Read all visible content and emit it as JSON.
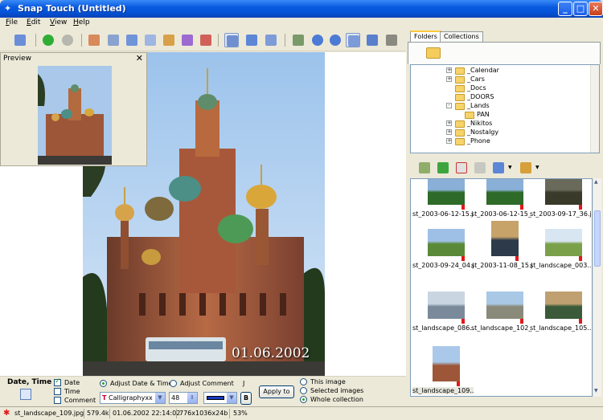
{
  "window": {
    "title": "Snap Touch (Untitled)"
  },
  "menu": [
    "File",
    "Edit",
    "View",
    "Help"
  ],
  "preview": {
    "title": "Preview"
  },
  "photo": {
    "date_stamp": "01.06.2002"
  },
  "bottom_panel": {
    "title": "Date, Time",
    "checkboxes": {
      "date": "Date",
      "time": "Time",
      "comment": "Comment"
    },
    "checked": {
      "date": true,
      "time": false,
      "comment": false
    },
    "adjust_date_time": "Adjust Date & Time",
    "adjust_comment": "Adjust Comment",
    "font": "Calligraphyxx",
    "size": "48",
    "bold_label": "B",
    "apply_button": "Apply to",
    "scope": {
      "this_image": "This image",
      "selected": "Selected images",
      "whole": "Whole collection"
    },
    "scope_selected": "whole",
    "extra_char": "J"
  },
  "status": {
    "filename": "st_landscape_109.jpg",
    "filesize": "579.4k",
    "datetime": "01.06.2002 22:14:02",
    "dimensions": "776x1036x24b",
    "zoom": "53%"
  },
  "tabs": [
    "Folders",
    "Collections"
  ],
  "tree": [
    {
      "label": "_Calendar",
      "level": 1,
      "expander": "+"
    },
    {
      "label": "_Cars",
      "level": 1,
      "expander": "+"
    },
    {
      "label": "_Docs",
      "level": 1,
      "expander": ""
    },
    {
      "label": "_DOORS",
      "level": 1,
      "expander": ""
    },
    {
      "label": "_Lands",
      "level": 1,
      "expander": "-"
    },
    {
      "label": "PAN",
      "level": 2,
      "expander": ""
    },
    {
      "label": "_Nikitos",
      "level": 1,
      "expander": "+"
    },
    {
      "label": "_Nostalgy",
      "level": 1,
      "expander": "+"
    },
    {
      "label": "_Phone",
      "level": 1,
      "expander": "+"
    }
  ],
  "thumbnails": [
    {
      "caption": "st_2003-06-12-15.jpg",
      "tone": "green"
    },
    {
      "caption": "st_2003-06-12-15_...",
      "tone": "green"
    },
    {
      "caption": "st_2003-09-17_36.jpg",
      "tone": "dark"
    },
    {
      "caption": "st_2003-09-24_04.jpg",
      "tone": "field"
    },
    {
      "caption": "st_2003-11-08_15.jpg",
      "tone": "dusk"
    },
    {
      "caption": "st_landscape_003...",
      "tone": "grass"
    },
    {
      "caption": "st_landscape_086...",
      "tone": "water"
    },
    {
      "caption": "st_landscape_102_...",
      "tone": "wall"
    },
    {
      "caption": "st_landscape_105...",
      "tone": "river"
    },
    {
      "caption": "st_landscape_109....",
      "tone": "church"
    }
  ],
  "colors": {
    "titlebar": "#0453d8",
    "panel": "#ece9d8",
    "accent": "#21a121"
  }
}
